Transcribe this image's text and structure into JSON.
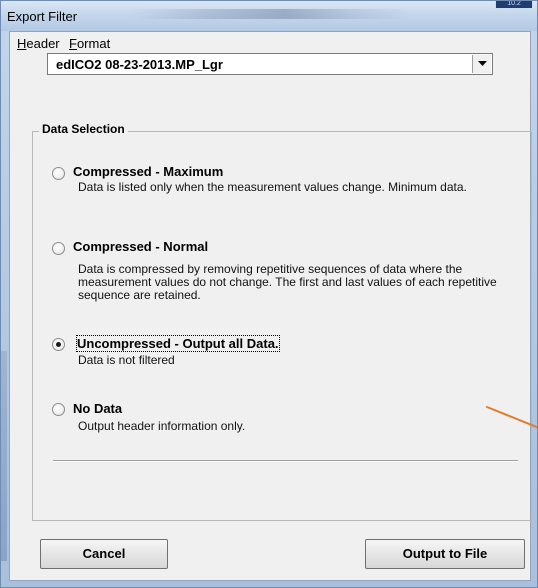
{
  "window": {
    "title": "Export Filter",
    "corner_badge": "10.2"
  },
  "menubar": {
    "items": [
      {
        "label": "Header",
        "accelerator": "H"
      },
      {
        "label": "Format",
        "accelerator": "F"
      }
    ]
  },
  "file_select": {
    "value": "edICO2 08-23-2013.MP_Lgr"
  },
  "data_selection": {
    "label": "Data Selection",
    "selected_index": 2,
    "options": [
      {
        "title": "Compressed - Maximum",
        "description": "Data is listed only when the measurement values change. Minimum data.",
        "checked": false
      },
      {
        "title": "Compressed - Normal",
        "description": "Data is compressed by removing repetitive sequences of data where the measurement values do not change. The first and last values of each repetitive sequence are retained.",
        "checked": false
      },
      {
        "title": "Uncompressed - Output all Data.",
        "description": "Data is not filtered",
        "checked": true
      },
      {
        "title": "No Data",
        "description": "Output header information only.",
        "checked": false
      }
    ]
  },
  "buttons": {
    "cancel_label": "Cancel",
    "output_label": "Output to File"
  },
  "colors": {
    "annotation_line": "#e07d2c",
    "window_frame": "#b8cce4",
    "client_bg": "#f0f0f0"
  },
  "icons": {
    "dropdown": "chevron-down-icon",
    "radio_empty": "radio-unchecked-icon",
    "radio_checked": "radio-checked-icon"
  }
}
